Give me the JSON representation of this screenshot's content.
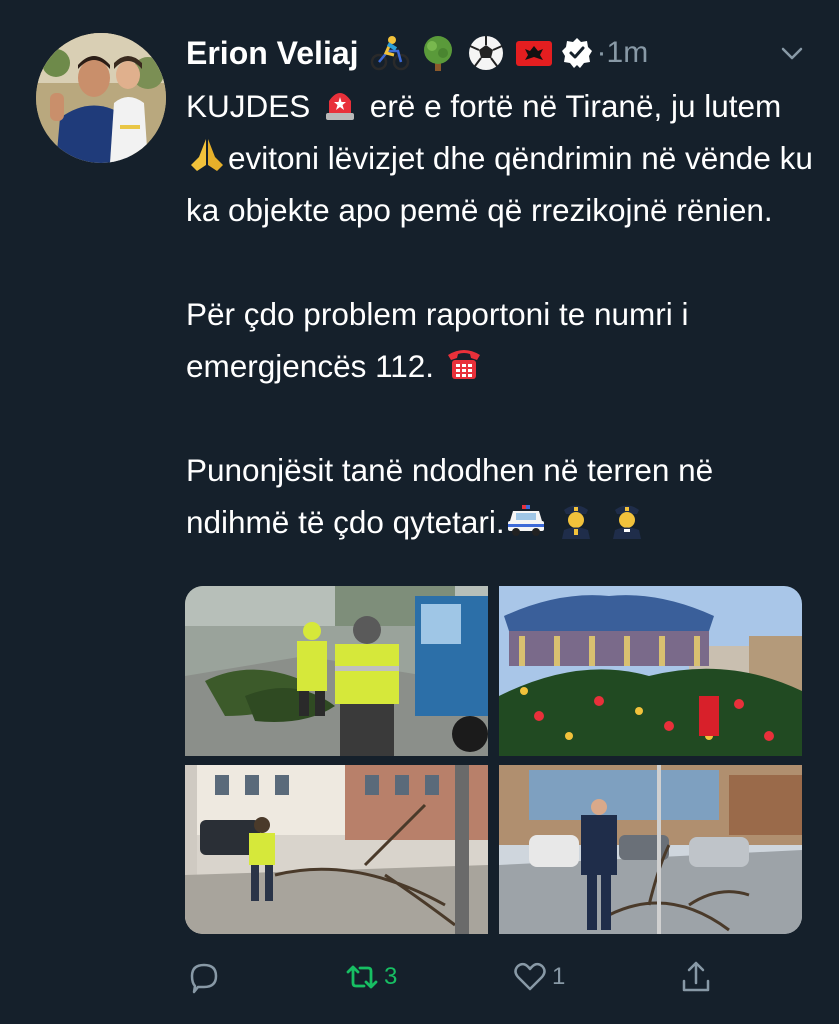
{
  "tweet": {
    "author_name": "Erion Veliaj",
    "time": "·1m",
    "name_emojis": [
      "cyclist-emoji",
      "tree-emoji",
      "soccer-ball-emoji",
      "albania-flag-emoji"
    ],
    "paragraph1": {
      "part1": "KUJDES",
      "part2": " erë e fortë në Tiranë, ju lutem",
      "part3": "evitoni lëvizjet dhe qëndrimin në vënde ku ka objekte apo pemë që rrezikojnë rënien."
    },
    "paragraph2": {
      "part1": "Për çdo problem raportoni te numri i emergjencës 112."
    },
    "paragraph3": {
      "part1": "Punonjësit tanë ndodhen në terren në ndihmë të çdo qytetari."
    },
    "photos": [
      "Worker in hi-vis vest clearing fallen tree branches near a truck",
      "Carousel and decorated Christmas tree in a square",
      "Worker in hi-vis vest beside a fallen tree on a sidewalk",
      "Police officer next to fallen tree on a street with parked cars"
    ],
    "actions": {
      "reply_count": "",
      "retweet_count": "3",
      "like_count": "1"
    },
    "colors": {
      "background": "#15202b",
      "text": "#ffffff",
      "muted": "#8899a6",
      "retweet_active": "#17bf63"
    }
  }
}
